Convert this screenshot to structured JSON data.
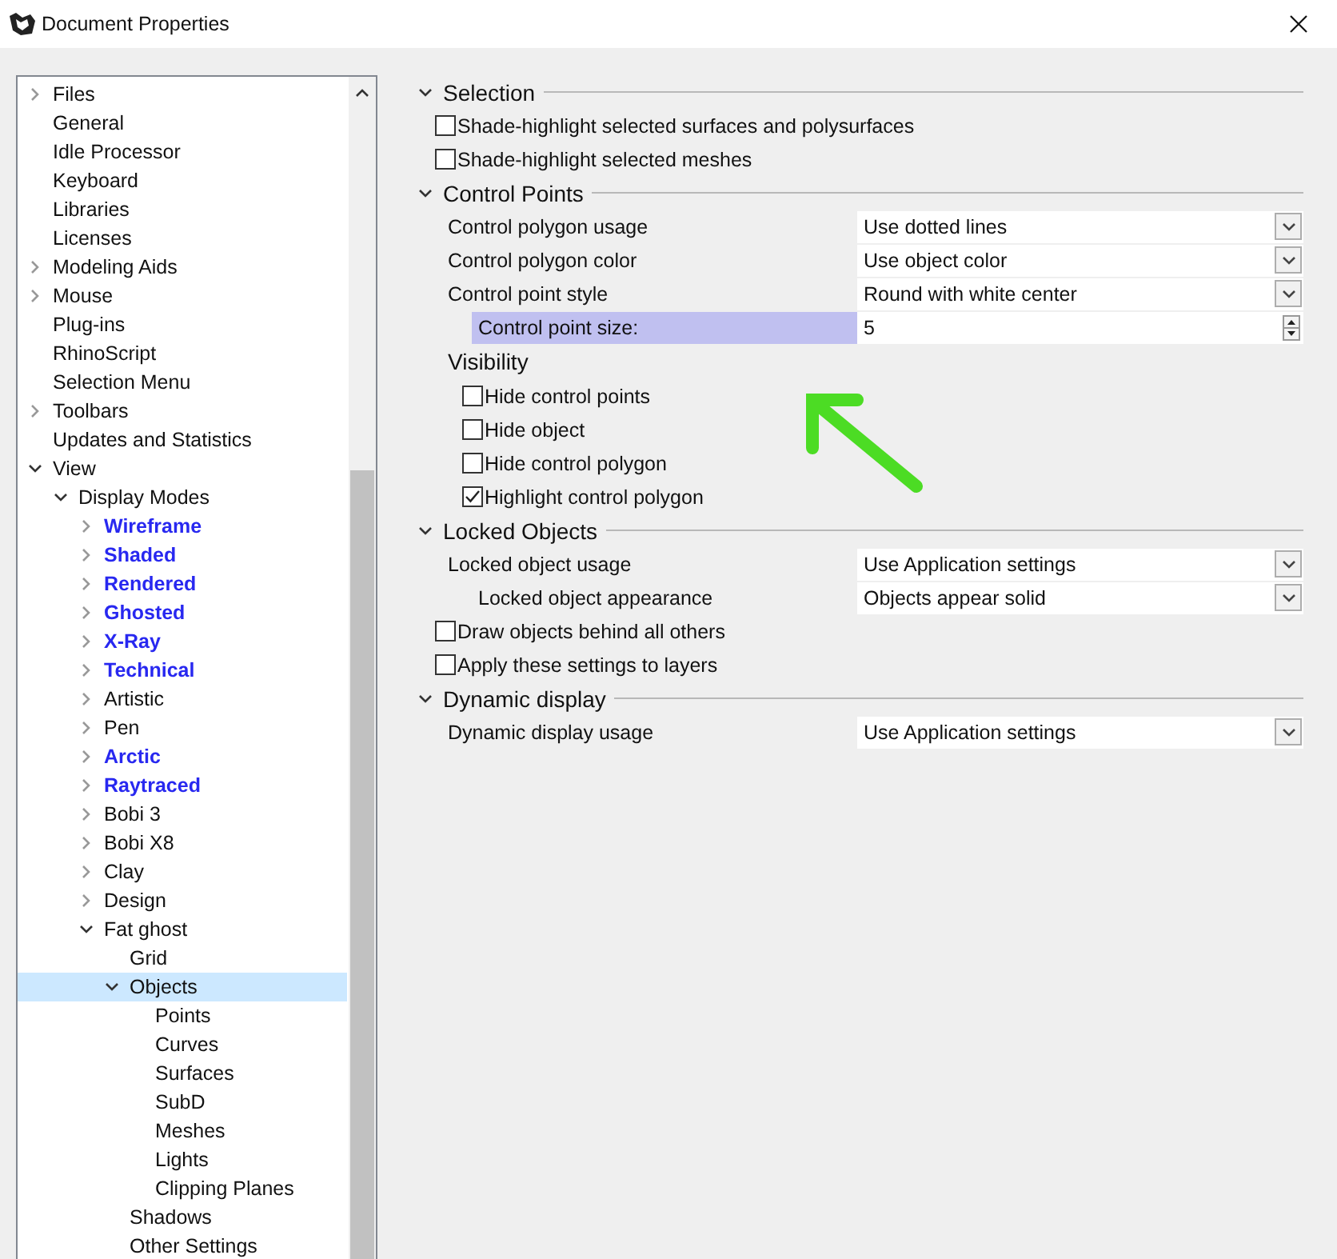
{
  "window": {
    "title": "Document Properties"
  },
  "tree": [
    {
      "label": "Files",
      "kind": "folder",
      "expanded": false,
      "selected": false
    },
    {
      "label": "General",
      "kind": "leaf",
      "selected": false
    },
    {
      "label": "Idle Processor",
      "kind": "leaf",
      "selected": false
    },
    {
      "label": "Keyboard",
      "kind": "leaf",
      "selected": false
    },
    {
      "label": "Libraries",
      "kind": "leaf",
      "selected": false
    },
    {
      "label": "Licenses",
      "kind": "leaf",
      "selected": false
    },
    {
      "label": "Modeling Aids",
      "kind": "folder",
      "expanded": false,
      "selected": false
    },
    {
      "label": "Mouse",
      "kind": "folder",
      "expanded": false,
      "selected": false
    },
    {
      "label": "Plug-ins",
      "kind": "leaf",
      "selected": false
    },
    {
      "label": "RhinoScript",
      "kind": "leaf",
      "selected": false
    },
    {
      "label": "Selection Menu",
      "kind": "leaf",
      "selected": false
    },
    {
      "label": "Toolbars",
      "kind": "folder",
      "expanded": false,
      "selected": false
    },
    {
      "label": "Updates and Statistics",
      "kind": "leaf",
      "selected": false
    },
    {
      "label": "View",
      "kind": "folder",
      "expanded": true,
      "selected": false,
      "children": [
        {
          "label": "Display Modes",
          "kind": "folder",
          "expanded": true,
          "selected": false,
          "children": [
            {
              "label": "Wireframe",
              "kind": "folder",
              "expanded": false,
              "bold": true,
              "selected": false
            },
            {
              "label": "Shaded",
              "kind": "folder",
              "expanded": false,
              "bold": true,
              "selected": false
            },
            {
              "label": "Rendered",
              "kind": "folder",
              "expanded": false,
              "bold": true,
              "selected": false
            },
            {
              "label": "Ghosted",
              "kind": "folder",
              "expanded": false,
              "bold": true,
              "selected": false
            },
            {
              "label": "X-Ray",
              "kind": "folder",
              "expanded": false,
              "bold": true,
              "selected": false
            },
            {
              "label": "Technical",
              "kind": "folder",
              "expanded": false,
              "bold": true,
              "selected": false
            },
            {
              "label": "Artistic",
              "kind": "folder",
              "expanded": false,
              "bold": false,
              "selected": false
            },
            {
              "label": "Pen",
              "kind": "folder",
              "expanded": false,
              "bold": false,
              "selected": false
            },
            {
              "label": "Arctic",
              "kind": "folder",
              "expanded": false,
              "bold": true,
              "selected": false
            },
            {
              "label": "Raytraced",
              "kind": "folder",
              "expanded": false,
              "bold": true,
              "selected": false
            },
            {
              "label": "Bobi 3",
              "kind": "folder",
              "expanded": false,
              "bold": false,
              "selected": false
            },
            {
              "label": "Bobi X8",
              "kind": "folder",
              "expanded": false,
              "bold": false,
              "selected": false
            },
            {
              "label": "Clay",
              "kind": "folder",
              "expanded": false,
              "bold": false,
              "selected": false
            },
            {
              "label": "Design",
              "kind": "folder",
              "expanded": false,
              "bold": false,
              "selected": false
            },
            {
              "label": "Fat ghost",
              "kind": "folder",
              "expanded": true,
              "bold": false,
              "selected": false,
              "children": [
                {
                  "label": "Grid",
                  "kind": "leaf",
                  "selected": false
                },
                {
                  "label": "Objects",
                  "kind": "folder",
                  "expanded": true,
                  "selected": true,
                  "children": [
                    {
                      "label": "Points",
                      "kind": "leaf",
                      "selected": false
                    },
                    {
                      "label": "Curves",
                      "kind": "leaf",
                      "selected": false
                    },
                    {
                      "label": "Surfaces",
                      "kind": "leaf",
                      "selected": false
                    },
                    {
                      "label": "SubD",
                      "kind": "leaf",
                      "selected": false
                    },
                    {
                      "label": "Meshes",
                      "kind": "leaf",
                      "selected": false
                    },
                    {
                      "label": "Lights",
                      "kind": "leaf",
                      "selected": false
                    },
                    {
                      "label": "Clipping Planes",
                      "kind": "leaf",
                      "selected": false
                    }
                  ]
                },
                {
                  "label": "Shadows",
                  "kind": "leaf",
                  "selected": false
                },
                {
                  "label": "Other Settings",
                  "kind": "leaf",
                  "selected": false
                }
              ]
            }
          ]
        }
      ]
    }
  ],
  "sections": [
    {
      "title": "Selection",
      "expanded": true,
      "items": [
        {
          "kind": "checkbox",
          "label": "Shade-highlight selected surfaces and polysurfaces",
          "checked": false
        },
        {
          "kind": "checkbox",
          "label": "Shade-highlight selected meshes",
          "checked": false
        }
      ]
    },
    {
      "title": "Control Points",
      "expanded": true,
      "items": [
        {
          "kind": "dropdown",
          "label": "Control polygon usage",
          "value": "Use dotted lines",
          "indented": false
        },
        {
          "kind": "dropdown",
          "label": "Control polygon color",
          "value": "Use object color",
          "indented": false
        },
        {
          "kind": "dropdown",
          "label": "Control point style",
          "value": "Round with white center",
          "indented": false
        },
        {
          "kind": "spinner",
          "label": "Control point size:",
          "value": "5",
          "highlighted": true
        },
        {
          "kind": "group",
          "label": "Visibility",
          "items": [
            {
              "kind": "checkbox",
              "label": "Hide control points",
              "checked": false
            },
            {
              "kind": "checkbox",
              "label": "Hide object",
              "checked": false
            },
            {
              "kind": "checkbox",
              "label": "Hide control polygon",
              "checked": false
            },
            {
              "kind": "checkbox",
              "label": "Highlight control polygon",
              "checked": true
            }
          ]
        }
      ]
    },
    {
      "title": "Locked Objects",
      "expanded": true,
      "items": [
        {
          "kind": "dropdown",
          "label": "Locked object usage",
          "value": "Use Application settings",
          "indented": false
        },
        {
          "kind": "dropdown",
          "label": "Locked object appearance",
          "value": "Objects appear solid",
          "indented": true
        },
        {
          "kind": "checkbox",
          "label": "Draw objects behind all others",
          "checked": false
        },
        {
          "kind": "checkbox",
          "label": "Apply these settings to layers",
          "checked": false
        }
      ]
    },
    {
      "title": "Dynamic display",
      "expanded": true,
      "items": [
        {
          "kind": "dropdown",
          "label": "Dynamic display usage",
          "value": "Use Application settings",
          "indented": false
        }
      ]
    }
  ],
  "annotations": [
    {
      "kind": "arrow",
      "color": "#4cdc24"
    }
  ]
}
